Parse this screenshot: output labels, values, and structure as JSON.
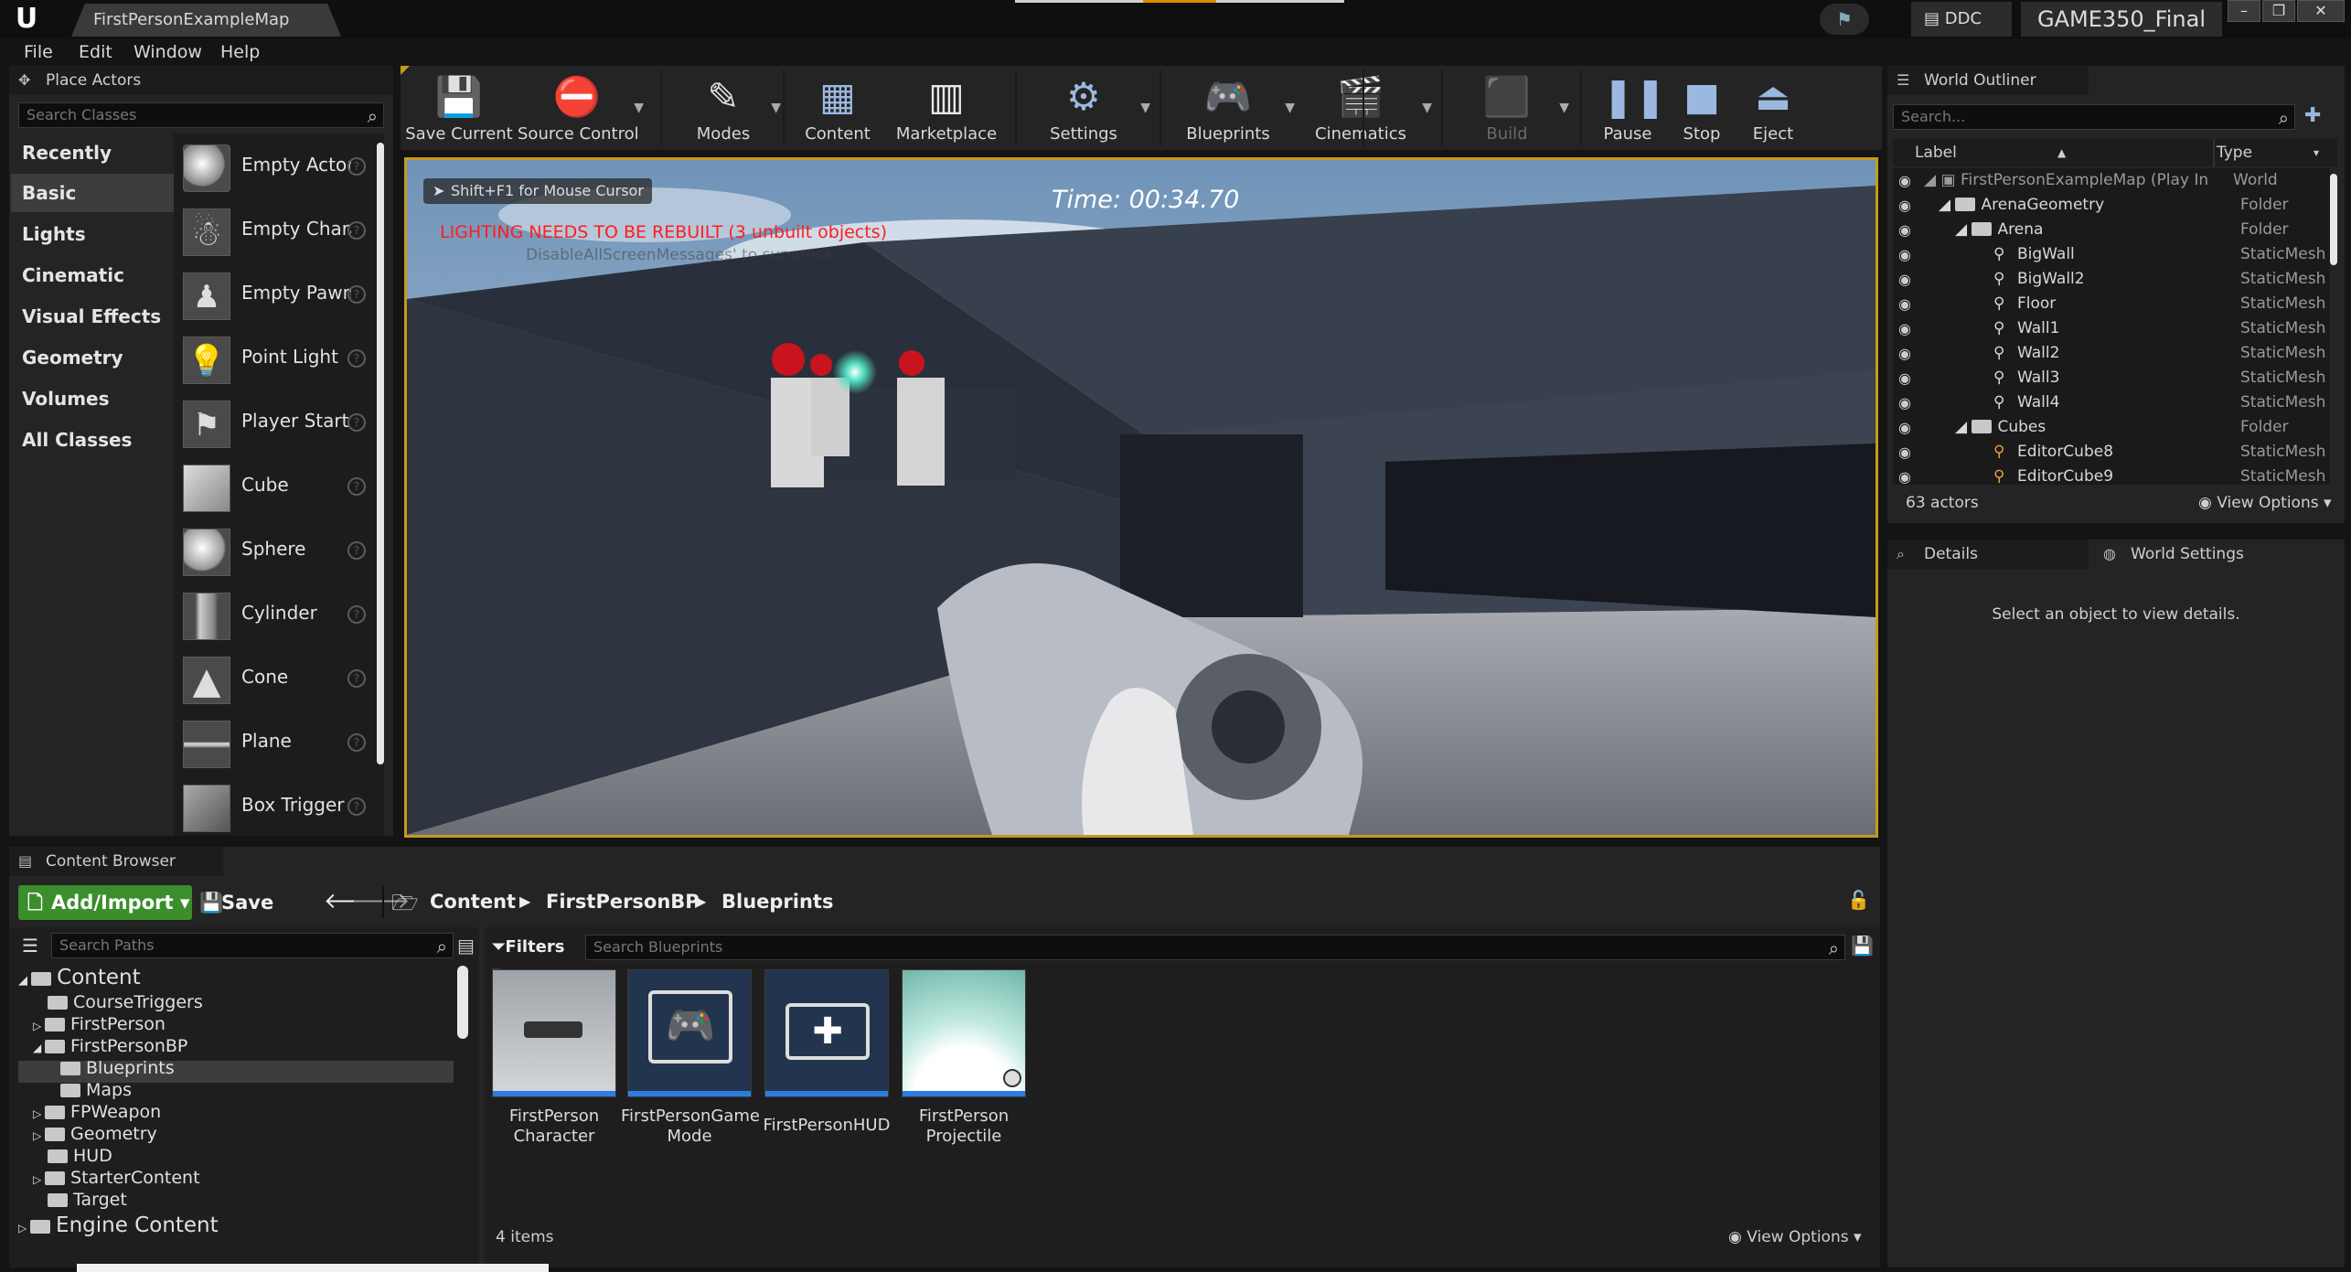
{
  "window": {
    "doc_tab": "FirstPersonExampleMap",
    "ddc": "DDC",
    "project": "GAME350_Final"
  },
  "menu": [
    "File",
    "Edit",
    "Window",
    "Help"
  ],
  "place_actors": {
    "title": "Place Actors",
    "search_placeholder": "Search Classes",
    "categories": [
      "Recently Placed",
      "Basic",
      "Lights",
      "Cinematic",
      "Visual Effects",
      "Geometry",
      "Volumes",
      "All Classes"
    ],
    "items": [
      "Empty Actor",
      "Empty Character",
      "Empty Pawn",
      "Point Light",
      "Player Start",
      "Cube",
      "Sphere",
      "Cylinder",
      "Cone",
      "Plane",
      "Box Trigger"
    ]
  },
  "toolbar": {
    "items": [
      "Save Current",
      "Source Control",
      "Modes",
      "Content",
      "Marketplace",
      "Settings",
      "Blueprints",
      "Cinematics",
      "Build",
      "Pause",
      "Stop",
      "Eject"
    ]
  },
  "viewport": {
    "cursor_hint": "Shift+F1 for Mouse Cursor",
    "timer": "Time: 00:34.70",
    "warning": "LIGHTING NEEDS TO BE REBUILT (3 unbuilt objects)",
    "suppress_hint": "DisableAllScreenMessages' to suppress"
  },
  "outliner": {
    "title": "World Outliner",
    "search_placeholder": "Search...",
    "col_label": "Label",
    "col_type": "Type",
    "rows": [
      {
        "label": "FirstPersonExampleMap (Play In",
        "type": "World"
      },
      {
        "label": "ArenaGeometry",
        "type": "Folder"
      },
      {
        "label": "Arena",
        "type": "Folder"
      },
      {
        "label": "BigWall",
        "type": "StaticMeshActo"
      },
      {
        "label": "BigWall2",
        "type": "StaticMeshActo"
      },
      {
        "label": "Floor",
        "type": "StaticMeshActo"
      },
      {
        "label": "Wall1",
        "type": "StaticMeshActo"
      },
      {
        "label": "Wall2",
        "type": "StaticMeshActo"
      },
      {
        "label": "Wall3",
        "type": "StaticMeshActo"
      },
      {
        "label": "Wall4",
        "type": "StaticMeshActo"
      },
      {
        "label": "Cubes",
        "type": "Folder"
      },
      {
        "label": "EditorCube8",
        "type": "StaticMeshActo"
      },
      {
        "label": "EditorCube9",
        "type": "StaticMeshActo"
      }
    ],
    "count": "63 actors",
    "view_options": "View Options"
  },
  "details": {
    "tab": "Details",
    "world_tab": "World Settings",
    "empty_msg": "Select an object to view details."
  },
  "content_browser": {
    "title": "Content Browser",
    "add_import": "Add/Import",
    "save_all": "Save All",
    "path": [
      "Content",
      "FirstPersonBP",
      "Blueprints"
    ],
    "search_paths": "Search Paths",
    "filters": "Filters",
    "search_assets": "Search Blueprints",
    "tree": [
      {
        "label": "Content",
        "depth": 0
      },
      {
        "label": "CourseTriggers",
        "depth": 1
      },
      {
        "label": "FirstPerson",
        "depth": 1
      },
      {
        "label": "FirstPersonBP",
        "depth": 1
      },
      {
        "label": "Blueprints",
        "depth": 2
      },
      {
        "label": "Maps",
        "depth": 2
      },
      {
        "label": "FPWeapon",
        "depth": 1
      },
      {
        "label": "Geometry",
        "depth": 1
      },
      {
        "label": "HUD",
        "depth": 1
      },
      {
        "label": "StarterContent",
        "depth": 1
      },
      {
        "label": "Target",
        "depth": 1
      },
      {
        "label": "Engine Content",
        "depth": 0
      }
    ],
    "assets": [
      {
        "line1": "FirstPerson",
        "line2": "Character"
      },
      {
        "line1": "FirstPersonGame",
        "line2": "Mode"
      },
      {
        "line1": "FirstPersonHUD",
        "line2": ""
      },
      {
        "line1": "FirstPerson",
        "line2": "Projectile"
      }
    ],
    "count": "4 items",
    "view_options": "View Options"
  }
}
